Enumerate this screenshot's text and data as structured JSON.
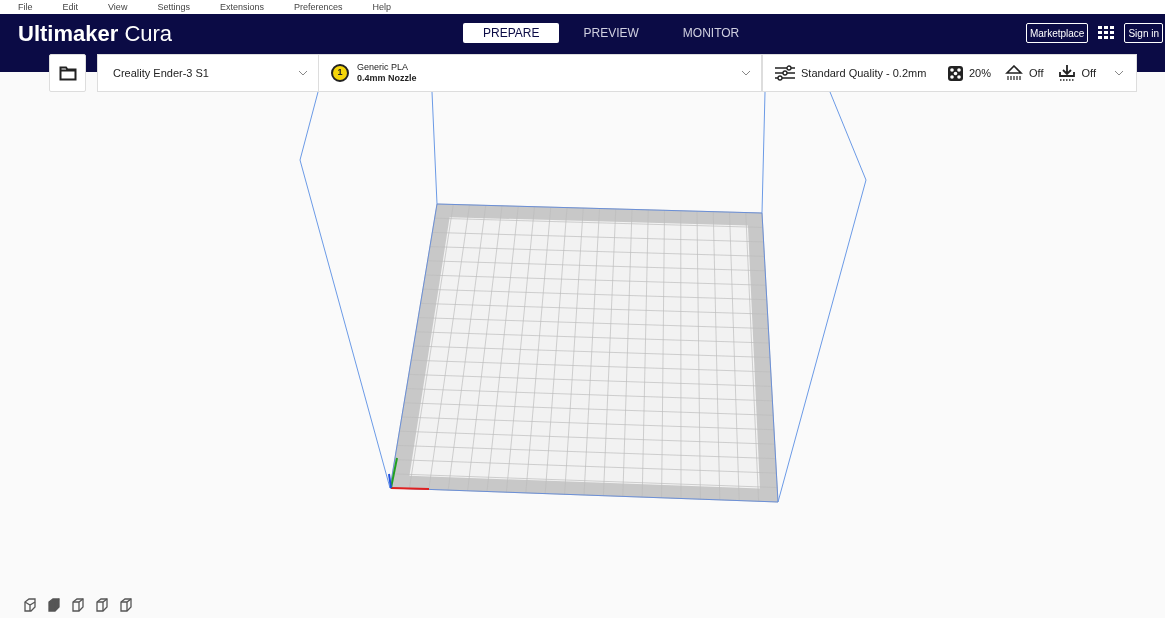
{
  "menu": [
    "File",
    "Edit",
    "View",
    "Settings",
    "Extensions",
    "Preferences",
    "Help"
  ],
  "logo": {
    "brand": "Ultimaker",
    "product": "Cura"
  },
  "stages": [
    {
      "label": "PREPARE",
      "selected": true
    },
    {
      "label": "PREVIEW",
      "selected": false
    },
    {
      "label": "MONITOR",
      "selected": false
    }
  ],
  "header_buttons": {
    "marketplace": "Marketplace",
    "sign_in": "Sign in"
  },
  "printer": {
    "name": "Creality Ender-3 S1"
  },
  "material": {
    "extruder": "1",
    "name": "Generic PLA",
    "nozzle": "0.4mm Nozzle"
  },
  "print_settings": {
    "profile": "Standard Quality - 0.2mm",
    "infill": "20%",
    "support": "Off",
    "adhesion": "Off"
  }
}
